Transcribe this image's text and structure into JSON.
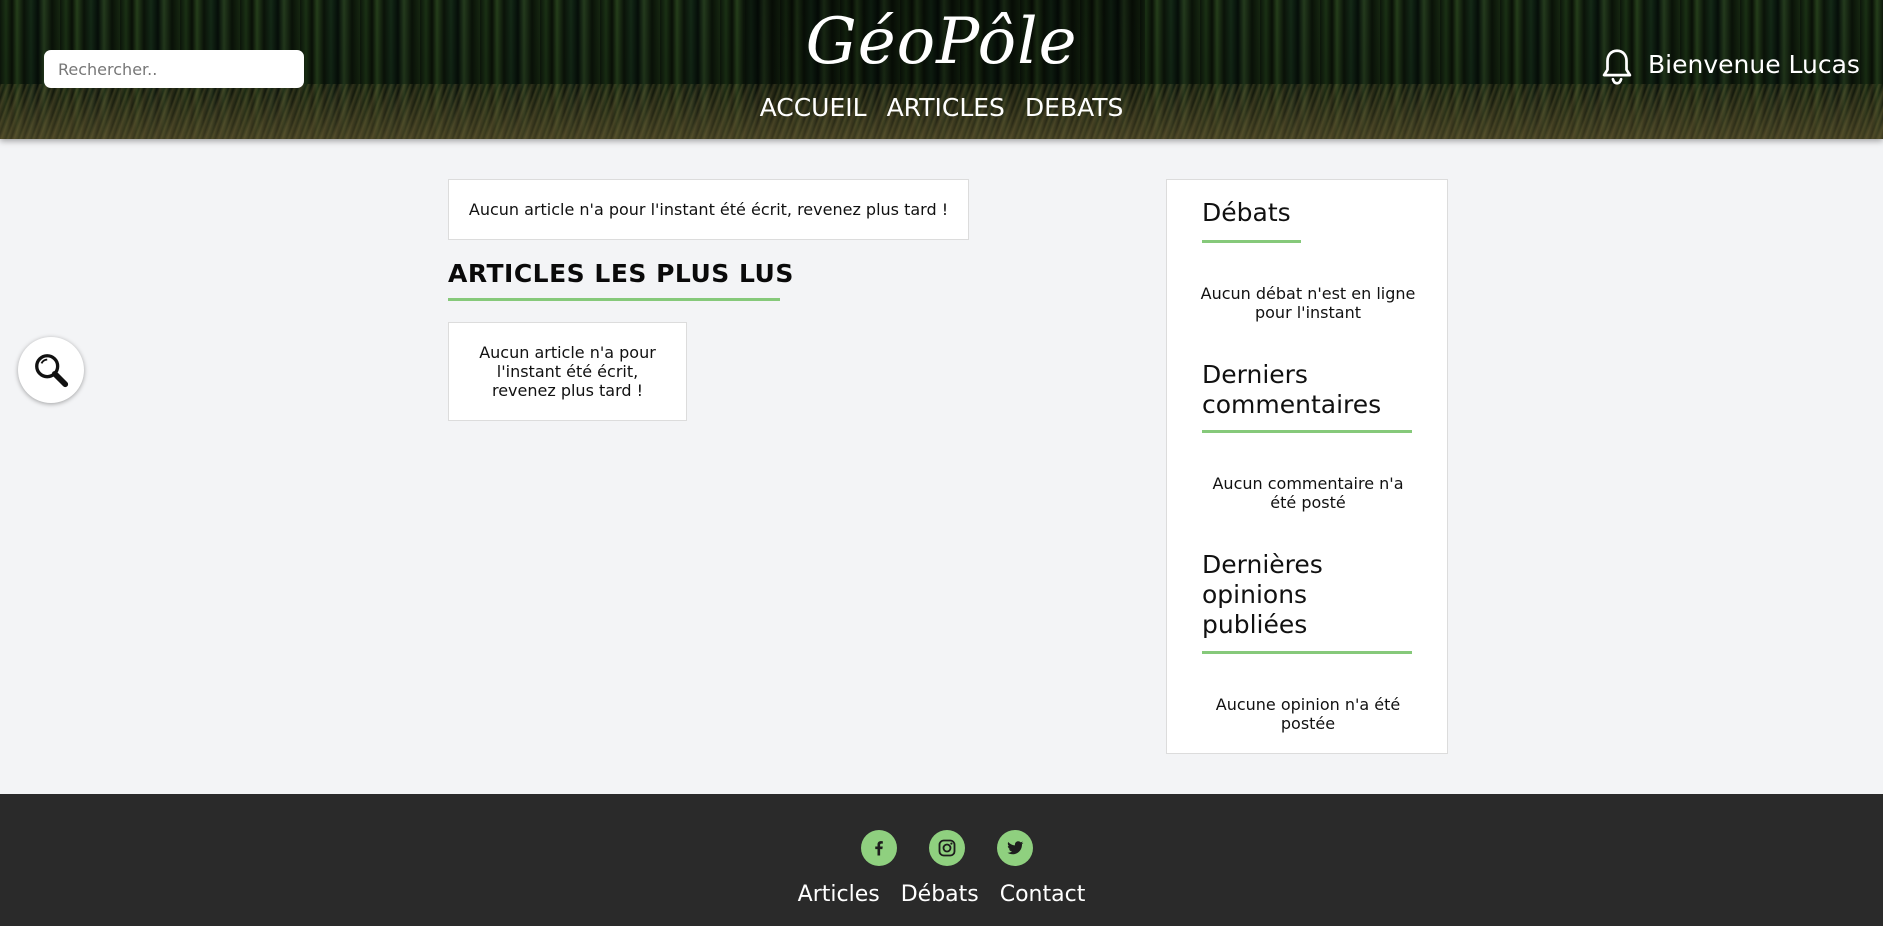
{
  "header": {
    "search_placeholder": "Rechercher..",
    "site_title": "GéoPôle",
    "nav": [
      {
        "label": "ACCUEIL"
      },
      {
        "label": "ARTICLES"
      },
      {
        "label": "DEBATS"
      }
    ],
    "notification_icon": "bell-icon",
    "welcome_text": "Bienvenue Lucas"
  },
  "floating_search": {
    "icon": "magnifier-icon"
  },
  "main": {
    "latest_notice": "Aucun article n'a pour l'instant été écrit, revenez plus tard !",
    "most_read_title": "ARTICLES LES PLUS LUS",
    "most_read_notice": "Aucun article n'a pour l'instant été écrit, revenez plus tard !"
  },
  "sidebar": {
    "debates_title": "Débats",
    "debates_empty": "Aucun débat n'est en ligne pour l'instant",
    "comments_title": "Derniers commentaires",
    "comments_empty": "Aucun commentaire n'a été posté",
    "opinions_title": "Dernières opinions publiées",
    "opinions_empty": "Aucune opinion n'a été postée"
  },
  "footer": {
    "social": [
      {
        "icon": "facebook-icon"
      },
      {
        "icon": "instagram-icon"
      },
      {
        "icon": "twitter-icon"
      }
    ],
    "links": [
      {
        "label": "Articles"
      },
      {
        "label": "Débats"
      },
      {
        "label": "Contact"
      }
    ]
  },
  "colors": {
    "accent_green": "#86c97a",
    "footer_bg": "#2a2a2a",
    "page_bg": "#f3f4f6"
  }
}
